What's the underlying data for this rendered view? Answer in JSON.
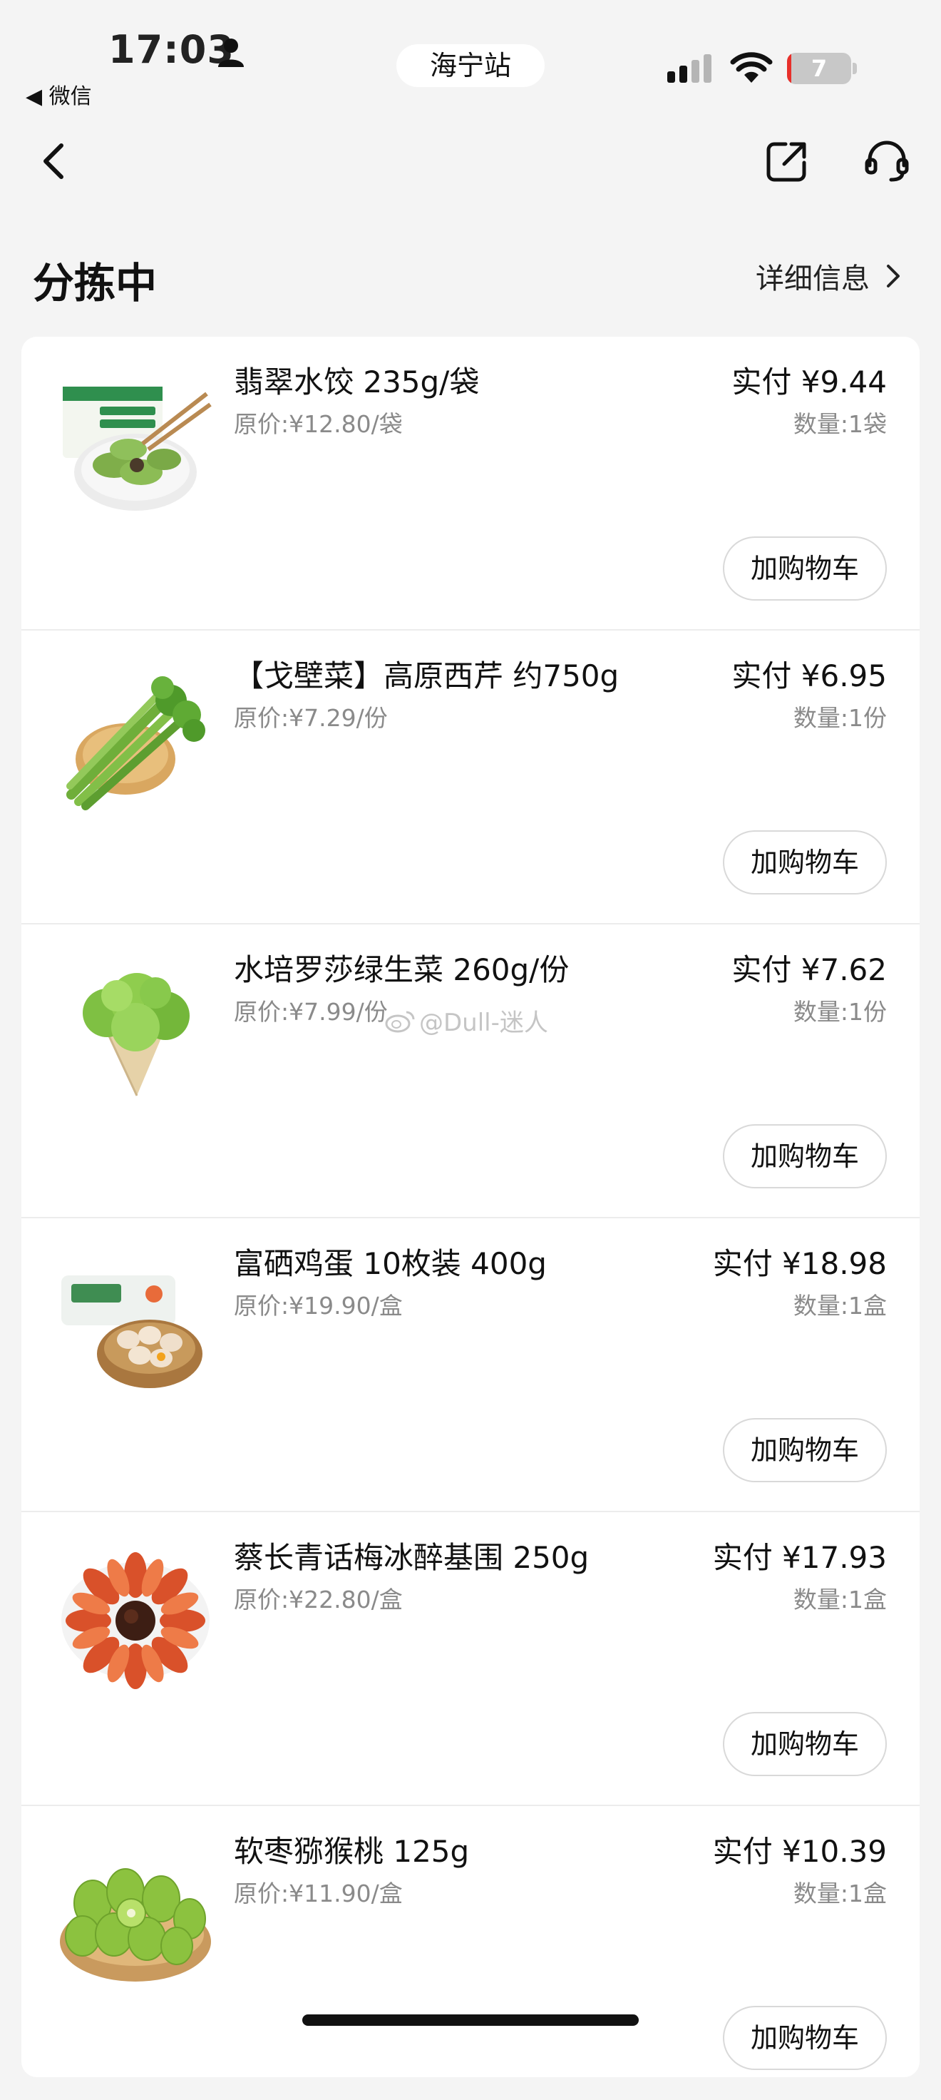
{
  "status_bar": {
    "time": "17:03",
    "back_app": "◀ 微信",
    "station": "海宁站",
    "battery": "7",
    "battery_level": 0.07
  },
  "header": {
    "title": "分拣中",
    "detail_link": "详细信息"
  },
  "items": [
    {
      "name": "翡翠水饺 235g/袋",
      "original": "原价:¥12.80/袋",
      "paid": "实付 ¥9.44",
      "qty": "数量:1袋",
      "button": "加购物车",
      "image": "dumplings-image"
    },
    {
      "name": "【戈壁菜】高原西芹 约750g",
      "original": "原价:¥7.29/份",
      "paid": "实付 ¥6.95",
      "qty": "数量:1份",
      "button": "加购物车",
      "image": "celery-image"
    },
    {
      "name": "水培罗莎绿生菜 260g/份",
      "original": "原价:¥7.99/份",
      "paid": "实付 ¥7.62",
      "qty": "数量:1份",
      "button": "加购物车",
      "image": "lettuce-image"
    },
    {
      "name": "富硒鸡蛋 10枚装 400g",
      "original": "原价:¥19.90/盒",
      "paid": "实付 ¥18.98",
      "qty": "数量:1盒",
      "button": "加购物车",
      "image": "eggs-image"
    },
    {
      "name": "蔡长青话梅冰醉基围 250g",
      "original": "原价:¥22.80/盒",
      "paid": "实付 ¥17.93",
      "qty": "数量:1盒",
      "button": "加购物车",
      "image": "shrimp-image"
    },
    {
      "name": "软枣猕猴桃 125g",
      "original": "原价:¥11.90/盒",
      "paid": "实付 ¥10.39",
      "qty": "数量:1盒",
      "button": "加购物车",
      "image": "kiwi-berry-image"
    }
  ],
  "watermark": "@Dull-迷人",
  "colors": {
    "background": "#f4f4f4",
    "card": "#ffffff",
    "battery_low": "#e8302b",
    "muted_text": "#8a8a8a"
  }
}
